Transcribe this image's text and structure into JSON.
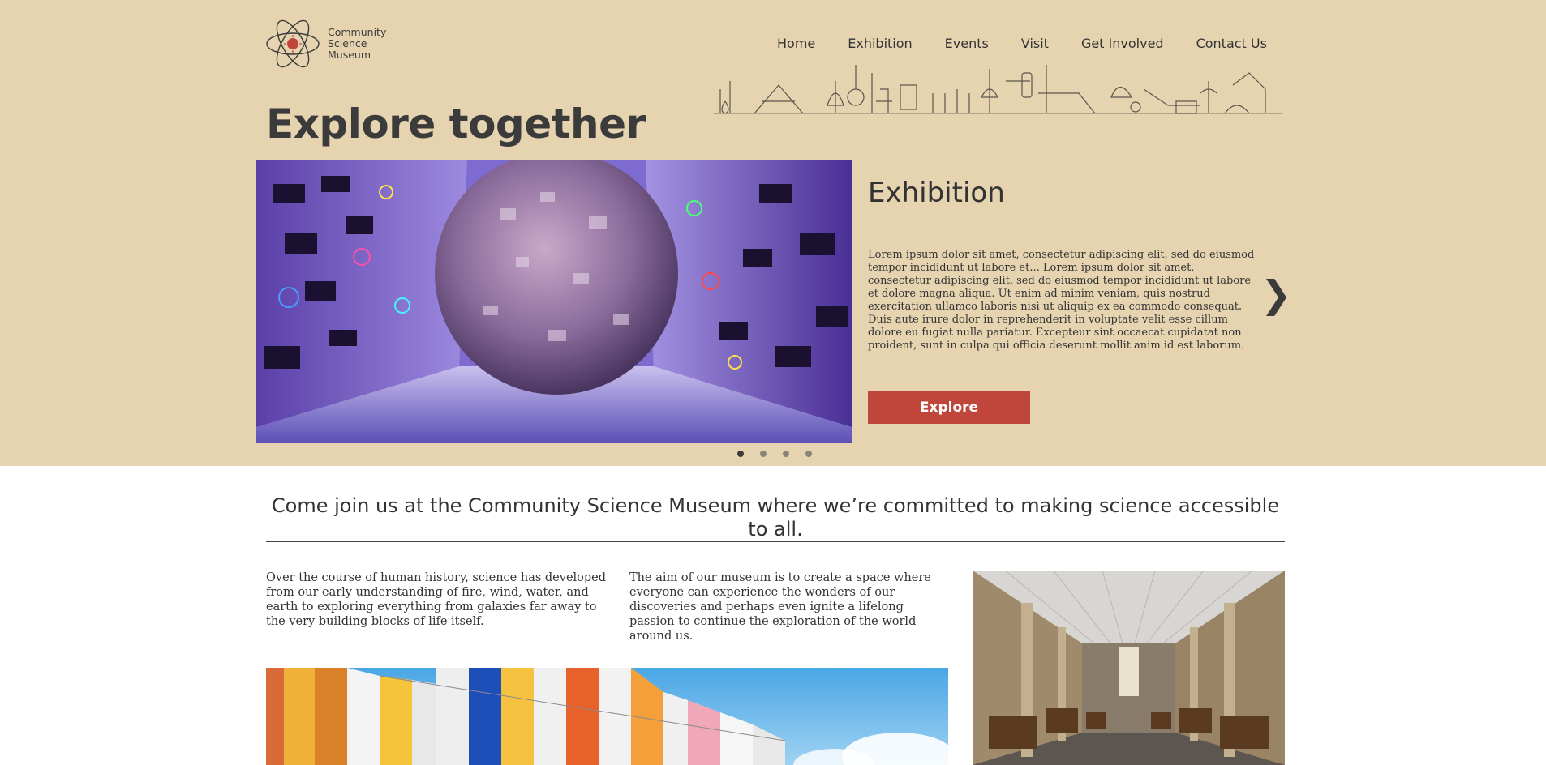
{
  "brand": {
    "name_lines": [
      "Community",
      "Science",
      "Museum"
    ],
    "icon": "atom-icon"
  },
  "nav": {
    "items": [
      {
        "label": "Home",
        "active": true
      },
      {
        "label": "Exhibition",
        "active": false
      },
      {
        "label": "Events",
        "active": false
      },
      {
        "label": "Visit",
        "active": false
      },
      {
        "label": "Get Involved",
        "active": false
      },
      {
        "label": "Contact Us",
        "active": false
      }
    ]
  },
  "hero": {
    "headline": "Explore together",
    "slide": {
      "title": "Exhibition",
      "description": "Lorem ipsum dolor sit amet, consectetur adipiscing elit, sed do eiusmod tempor incididunt ut labore et... Lorem ipsum dolor sit amet, consectetur adipiscing elit, sed do eiusmod tempor incididunt ut labore et dolore magna aliqua. Ut enim ad minim veniam, quis nostrud exercitation ullamco laboris nisi ut aliquip ex ea commodo consequat. Duis aute irure dolor in reprehenderit in voluptate velit esse cillum dolore eu fugiat nulla pariatur. Excepteur sint occaecat cupidatat non proident, sunt in culpa qui officia deserunt mollit anim id est laborum.",
      "button_label": "Explore"
    },
    "next_arrow": "❯",
    "slide_count": 4,
    "active_slide": 1
  },
  "intro": {
    "heading": "Come join us at the Community Science Museum where we’re committed to making science accessible to all.",
    "col1": "Over the course of human history, science has developed from our early understanding of fire, wind, water, and earth to exploring everything from galaxies far away to the very building blocks of life itself.",
    "col2": "The aim of our museum is to create a space where everyone can experience the wonders of our discoveries and perhaps even ignite a lifelong passion to continue the exploration of the world around us."
  },
  "colors": {
    "hero_bg": "#e6d4b1",
    "accent_button": "#c0453a",
    "text_dark": "#3b3b3b"
  }
}
